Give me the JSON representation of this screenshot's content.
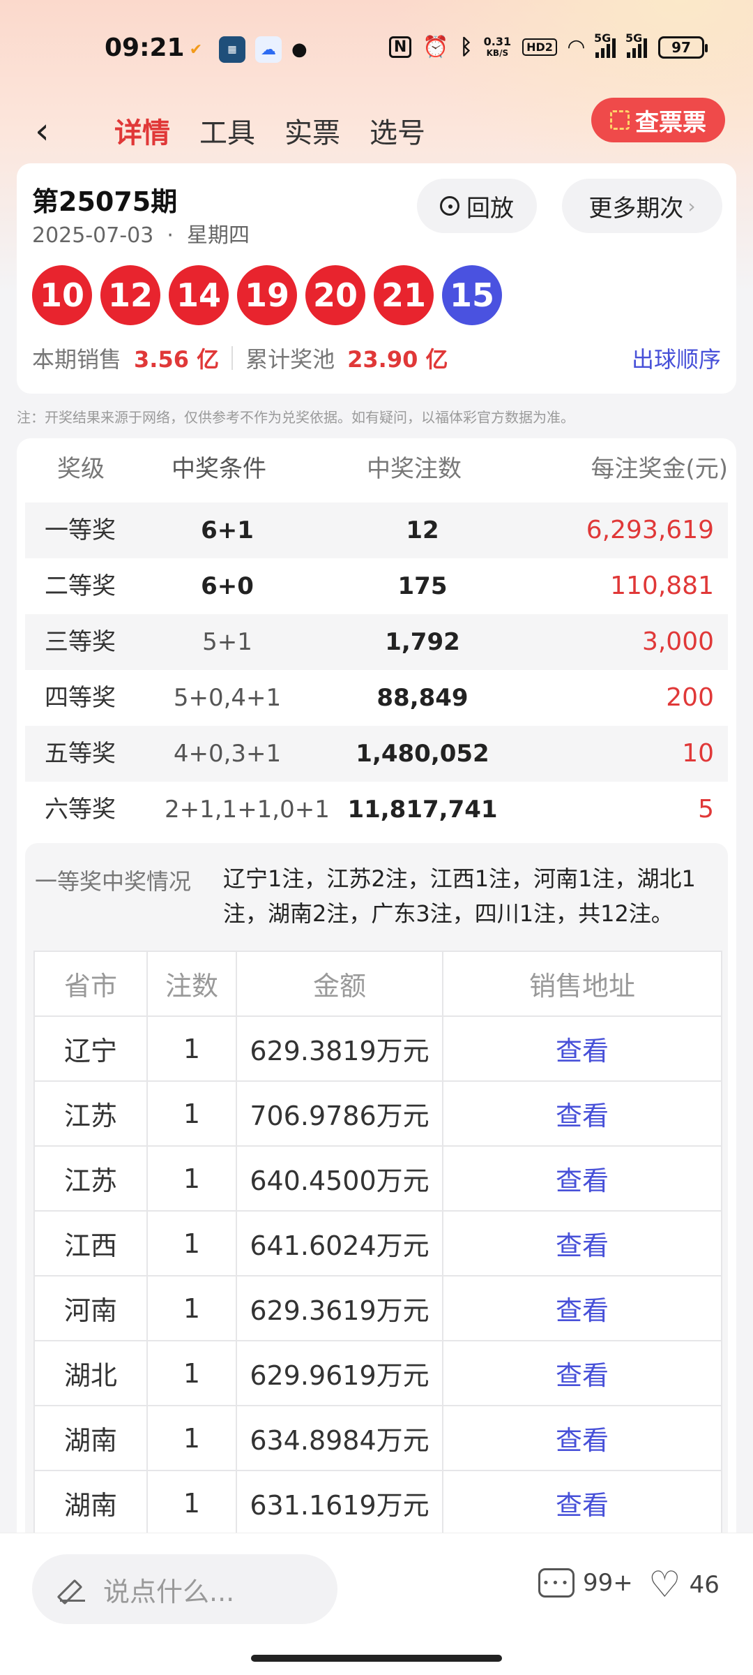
{
  "status": {
    "time": "09:21",
    "speed_value": "0.31",
    "speed_unit": "KB/S",
    "hd": "HD2",
    "sig1": "5G",
    "sig2": "5G",
    "battery": "97"
  },
  "header": {
    "tabs": [
      "详情",
      "工具",
      "实票",
      "选号"
    ],
    "active_tab": 0,
    "check_ticket": "查票票"
  },
  "draw": {
    "issue": "第25075期",
    "date": "2025-07-03  ·  星期四",
    "replay": "回放",
    "more": "更多期次",
    "red_balls": [
      "10",
      "12",
      "14",
      "19",
      "20",
      "21"
    ],
    "blue_ball": "15",
    "sales_label": "本期销售",
    "sales_value": "3.56 亿",
    "pool_label": "累计奖池",
    "pool_value": "23.90 亿",
    "order_link": "出球顺序"
  },
  "note": "注：开奖结果来源于网络，仅供参考不作为兑奖依据。如有疑问，以福体彩官方数据为准。",
  "prize_table": {
    "headers": [
      "奖级",
      "中奖条件",
      "中奖注数",
      "每注奖金(元)"
    ],
    "rows": [
      {
        "level": "一等奖",
        "cond": "6+1",
        "count": "12",
        "amount": "6,293,619"
      },
      {
        "level": "二等奖",
        "cond": "6+0",
        "count": "175",
        "amount": "110,881"
      },
      {
        "level": "三等奖",
        "cond": "5+1",
        "count": "1,792",
        "amount": "3,000"
      },
      {
        "level": "四等奖",
        "cond": "5+0,4+1",
        "count": "88,849",
        "amount": "200"
      },
      {
        "level": "五等奖",
        "cond": "4+0,3+1",
        "count": "1,480,052",
        "amount": "10"
      },
      {
        "level": "六等奖",
        "cond": "2+1,1+1,0+1",
        "count": "11,817,741",
        "amount": "5"
      }
    ]
  },
  "first_prize": {
    "label": "一等奖中奖情况",
    "summary": "辽宁1注，江苏2注，江西1注，河南1注，湖北1注，湖南2注，广东3注，四川1注，共12注。",
    "headers": [
      "省市",
      "注数",
      "金额",
      "销售地址"
    ],
    "rows": [
      {
        "prov": "辽宁",
        "n": "1",
        "amt": "629.3819万元",
        "link": "查看"
      },
      {
        "prov": "江苏",
        "n": "1",
        "amt": "706.9786万元",
        "link": "查看"
      },
      {
        "prov": "江苏",
        "n": "1",
        "amt": "640.4500万元",
        "link": "查看"
      },
      {
        "prov": "江西",
        "n": "1",
        "amt": "641.6024万元",
        "link": "查看"
      },
      {
        "prov": "河南",
        "n": "1",
        "amt": "629.3619万元",
        "link": "查看"
      },
      {
        "prov": "湖北",
        "n": "1",
        "amt": "629.9619万元",
        "link": "查看"
      },
      {
        "prov": "湖南",
        "n": "1",
        "amt": "634.8984万元",
        "link": "查看"
      },
      {
        "prov": "湖南",
        "n": "1",
        "amt": "631.1619万元",
        "link": "查看"
      }
    ]
  },
  "bottom": {
    "placeholder": "说点什么...",
    "comments": "99+",
    "likes": "46"
  }
}
